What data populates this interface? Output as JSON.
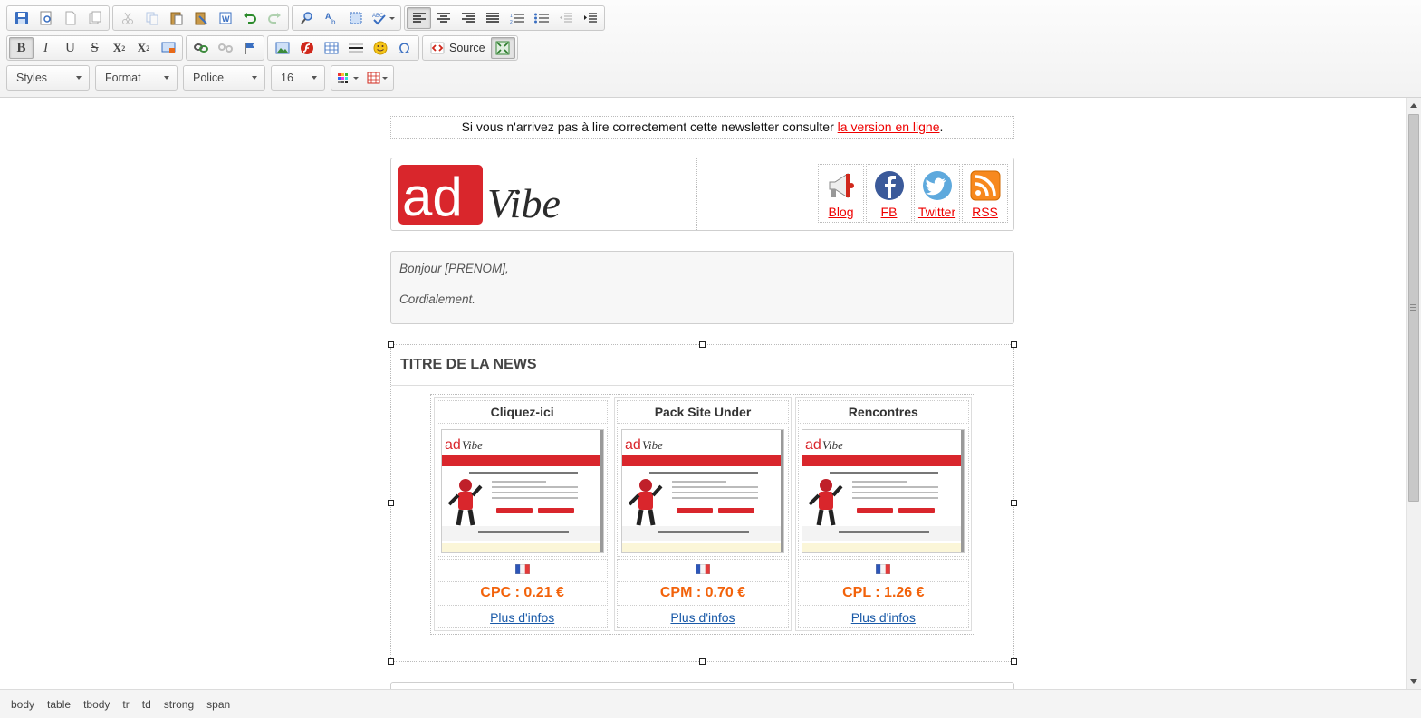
{
  "toolbar": {
    "row1": [
      "save-icon",
      "preview-icon",
      "new-page-icon",
      "templates-icon",
      "cut-icon",
      "copy-icon",
      "paste-icon",
      "paste-text-icon",
      "paste-word-icon",
      "undo-icon",
      "redo-icon",
      "find-icon",
      "replace-icon",
      "select-all-icon",
      "spellcheck-icon",
      "align-left-icon",
      "align-center-icon",
      "align-right-icon",
      "justify-icon",
      "numbered-list-icon",
      "bulleted-list-icon",
      "outdent-icon",
      "indent-icon"
    ],
    "row2": [
      "bold-icon",
      "italic-icon",
      "underline-icon",
      "strike-icon",
      "subscript-icon",
      "superscript-icon",
      "remove-format-icon",
      "link-icon",
      "unlink-icon",
      "anchor-icon",
      "image-icon",
      "flash-icon",
      "table-icon",
      "hr-icon",
      "smiley-icon",
      "special-char-icon"
    ],
    "source_label": "Source",
    "styles_label": "Styles",
    "format_label": "Format",
    "font_label": "Police",
    "size_label": "16"
  },
  "notice": {
    "text": "Si vous n'arrivez pas à lire correctement cette newsletter consulter ",
    "link": "la version en ligne",
    "end": "."
  },
  "header": {
    "logo_ad": "ad",
    "logo_vibe": "Vibe",
    "socials": [
      {
        "label": "Blog",
        "icon": "megaphone-icon"
      },
      {
        "label": "FB",
        "icon": "facebook-icon"
      },
      {
        "label": "Twitter",
        "icon": "twitter-icon"
      },
      {
        "label": "RSS",
        "icon": "rss-icon"
      }
    ]
  },
  "greeting": {
    "hello": "Bonjour [PRENOM],",
    "closing": "Cordialement."
  },
  "news": {
    "title": "TITRE DE LA NEWS",
    "offers": [
      {
        "title": "Cliquez-ici",
        "price": "CPC : 0.21 €",
        "more": "Plus d'infos"
      },
      {
        "title": "Pack Site Under",
        "price": "CPM : 0.70 €",
        "more": "Plus d'infos"
      },
      {
        "title": "Rencontres",
        "price": "CPL : 1.26 €",
        "more": "Plus d'infos"
      }
    ]
  },
  "colors": {
    "brand_red": "#d9262c",
    "link_red": "#ee0000",
    "price_orange": "#f2620a",
    "link_blue": "#1a5aa8"
  },
  "statusbar": {
    "path": [
      "body",
      "table",
      "tbody",
      "tr",
      "td",
      "strong",
      "span"
    ]
  }
}
